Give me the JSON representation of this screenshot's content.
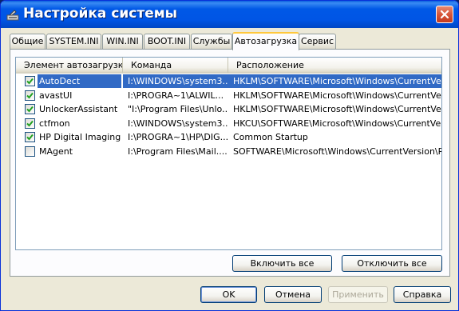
{
  "window": {
    "title": "Настройка системы"
  },
  "tabs": [
    {
      "label": "Общие"
    },
    {
      "label": "SYSTEM.INI"
    },
    {
      "label": "WIN.INI"
    },
    {
      "label": "BOOT.INI"
    },
    {
      "label": "Службы"
    },
    {
      "label": "Автозагрузка",
      "active": true
    },
    {
      "label": "Сервис"
    }
  ],
  "startup": {
    "columns": [
      "Элемент автозагрузки",
      "Команда",
      "Расположение"
    ],
    "rows": [
      {
        "checked": true,
        "selected": true,
        "name": "AutoDect",
        "command": "I:\\WINDOWS\\system3...",
        "location": "HKLM\\SOFTWARE\\Microsoft\\Windows\\CurrentVer..."
      },
      {
        "checked": true,
        "selected": false,
        "name": "avastUI",
        "command": "I:\\PROGRA~1\\ALWIL...",
        "location": "HKLM\\SOFTWARE\\Microsoft\\Windows\\CurrentVer..."
      },
      {
        "checked": true,
        "selected": false,
        "name": "UnlockerAssistant",
        "command": "\"I:\\Program Files\\Unlo...",
        "location": "HKLM\\SOFTWARE\\Microsoft\\Windows\\CurrentVer..."
      },
      {
        "checked": true,
        "selected": false,
        "name": "ctfmon",
        "command": "I:\\WINDOWS\\system3...",
        "location": "HKCU\\SOFTWARE\\Microsoft\\Windows\\CurrentVer..."
      },
      {
        "checked": true,
        "selected": false,
        "name": "HP Digital Imaging ...",
        "command": "I:\\PROGRA~1\\HP\\DIG...",
        "location": "Common Startup"
      },
      {
        "checked": false,
        "selected": false,
        "name": "MAgent",
        "command": "I:\\Program Files\\Mail....",
        "location": "SOFTWARE\\Microsoft\\Windows\\CurrentVersion\\Run"
      }
    ],
    "enable_all": "Включить все",
    "disable_all": "Отключить все"
  },
  "footer": {
    "ok": "OK",
    "cancel": "Отмена",
    "apply": "Применить",
    "help": "Справка"
  },
  "colors": {
    "titlebar": "#0055e5",
    "selection": "#316ac5",
    "active_tab_accent": "#ffc83c",
    "close_button": "#d7563a"
  }
}
